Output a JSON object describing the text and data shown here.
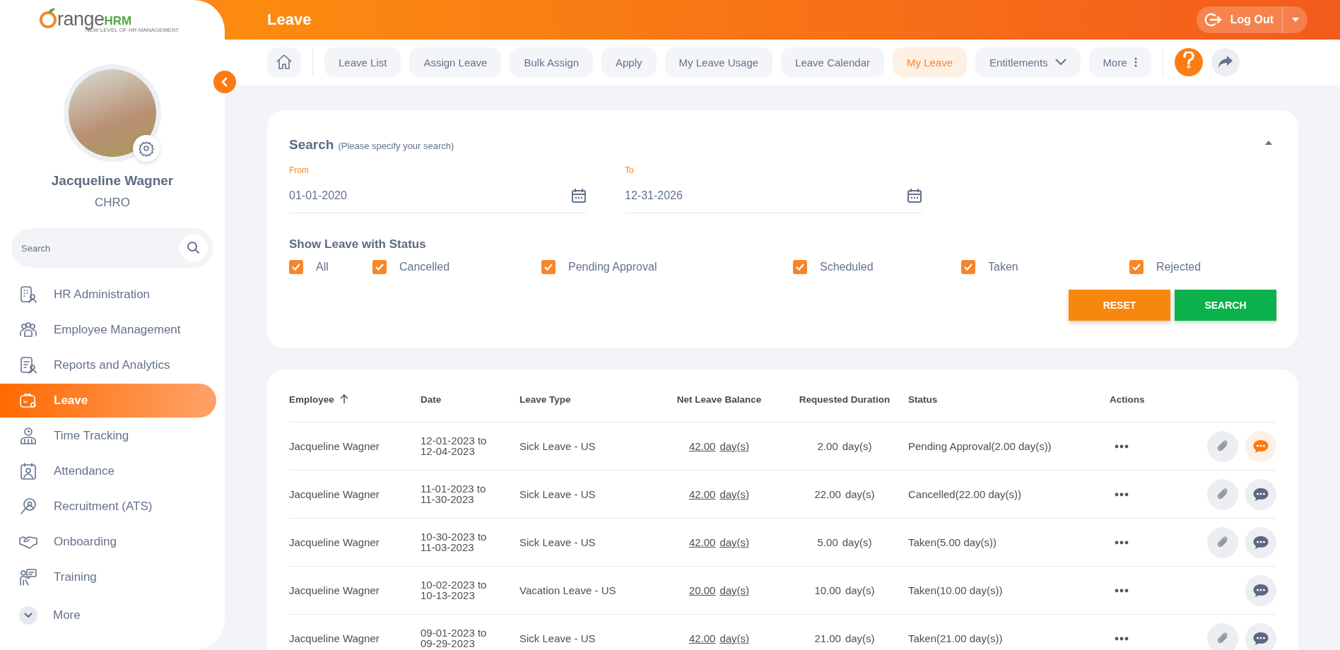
{
  "sidebar": {
    "logo": {
      "brand": "range",
      "accent": "HRM",
      "tagline": "NEW LEVEL OF HR MANAGEMENT"
    },
    "user": {
      "name": "Jacqueline Wagner",
      "role": "CHRO"
    },
    "search": {
      "placeholder": "Search"
    },
    "items": [
      {
        "label": "HR Administration",
        "selected": false,
        "kind": "module"
      },
      {
        "label": "Employee Management",
        "selected": false,
        "kind": "module"
      },
      {
        "label": "Reports and Analytics",
        "selected": false,
        "kind": "module"
      },
      {
        "label": "Leave",
        "selected": true,
        "kind": "module"
      },
      {
        "label": "Time Tracking",
        "selected": false,
        "kind": "module"
      },
      {
        "label": "Attendance",
        "selected": false,
        "kind": "module"
      },
      {
        "label": "Recruitment (ATS)",
        "selected": false,
        "kind": "module"
      },
      {
        "label": "Onboarding",
        "selected": false,
        "kind": "module"
      },
      {
        "label": "Training",
        "selected": false,
        "kind": "module"
      },
      {
        "label": "More",
        "selected": false,
        "kind": "more"
      }
    ]
  },
  "header": {
    "title": "Leave",
    "logout": "Log Out"
  },
  "toolbar": {
    "tabs": [
      {
        "label": "Leave List",
        "selected": false,
        "kind": "plain"
      },
      {
        "label": "Assign Leave",
        "selected": false,
        "kind": "plain"
      },
      {
        "label": "Bulk Assign",
        "selected": false,
        "kind": "plain"
      },
      {
        "label": "Apply",
        "selected": false,
        "kind": "plain"
      },
      {
        "label": "My Leave Usage",
        "selected": false,
        "kind": "plain"
      },
      {
        "label": "Leave Calendar",
        "selected": false,
        "kind": "plain"
      },
      {
        "label": "My Leave",
        "selected": true,
        "kind": "plain"
      },
      {
        "label": "Entitlements",
        "selected": false,
        "kind": "dropdown"
      },
      {
        "label": "More",
        "selected": false,
        "kind": "more"
      }
    ]
  },
  "search_panel": {
    "expanded": true,
    "title": "Search",
    "hint": "(Please specify your search)",
    "from": {
      "label": "From",
      "value": "01-01-2020"
    },
    "to": {
      "label": "To",
      "value": "12-31-2026"
    },
    "status_label": "Show Leave with Status",
    "statuses": [
      {
        "label": "All",
        "checked": true
      },
      {
        "label": "Cancelled",
        "checked": true
      },
      {
        "label": "Pending Approval",
        "checked": true
      },
      {
        "label": "Scheduled",
        "checked": true
      },
      {
        "label": "Taken",
        "checked": true
      },
      {
        "label": "Rejected",
        "checked": true
      }
    ],
    "buttons": [
      {
        "label": "RESET",
        "kind": "reset"
      },
      {
        "label": "SEARCH",
        "kind": "search"
      }
    ]
  },
  "table": {
    "columns": [
      {
        "label": "Employee",
        "sorted": true
      },
      {
        "label": "Date",
        "sorted": false
      },
      {
        "label": "Leave Type",
        "sorted": false
      },
      {
        "label": "Net Leave Balance",
        "sorted": false
      },
      {
        "label": "Requested Duration",
        "sorted": false
      },
      {
        "label": "Status",
        "sorted": false
      },
      {
        "label": "Actions",
        "sorted": false
      }
    ],
    "rows": [
      {
        "employee": "Jacqueline Wagner",
        "date": "12-01-2023 to 12-04-2023",
        "leave_type": "Sick Leave - US",
        "balance": "42.00",
        "balance_unit": "day(s)",
        "duration": "2.00",
        "duration_unit": "day(s)",
        "status": "Pending Approval(2.00 day(s))",
        "has_attachment": true,
        "comment_highlighted": true
      },
      {
        "employee": "Jacqueline Wagner",
        "date": "11-01-2023 to 11-30-2023",
        "leave_type": "Sick Leave - US",
        "balance": "42.00",
        "balance_unit": "day(s)",
        "duration": "22.00",
        "duration_unit": "day(s)",
        "status": "Cancelled(22.00 day(s))",
        "has_attachment": true,
        "comment_highlighted": false
      },
      {
        "employee": "Jacqueline Wagner",
        "date": "10-30-2023 to 11-03-2023",
        "leave_type": "Sick Leave - US",
        "balance": "42.00",
        "balance_unit": "day(s)",
        "duration": "5.00",
        "duration_unit": "day(s)",
        "status": "Taken(5.00 day(s))",
        "has_attachment": true,
        "comment_highlighted": false
      },
      {
        "employee": "Jacqueline Wagner",
        "date": "10-02-2023 to 10-13-2023",
        "leave_type": "Vacation Leave - US",
        "balance": "20.00",
        "balance_unit": "day(s)",
        "duration": "10.00",
        "duration_unit": "day(s)",
        "status": "Taken(10.00 day(s))",
        "has_attachment": false,
        "comment_highlighted": false
      },
      {
        "employee": "Jacqueline Wagner",
        "date": "09-01-2023 to 09-29-2023",
        "leave_type": "Sick Leave - US",
        "balance": "42.00",
        "balance_unit": "day(s)",
        "duration": "21.00",
        "duration_unit": "day(s)",
        "status": "Taken(21.00 day(s))",
        "has_attachment": true,
        "comment_highlighted": false
      }
    ]
  }
}
